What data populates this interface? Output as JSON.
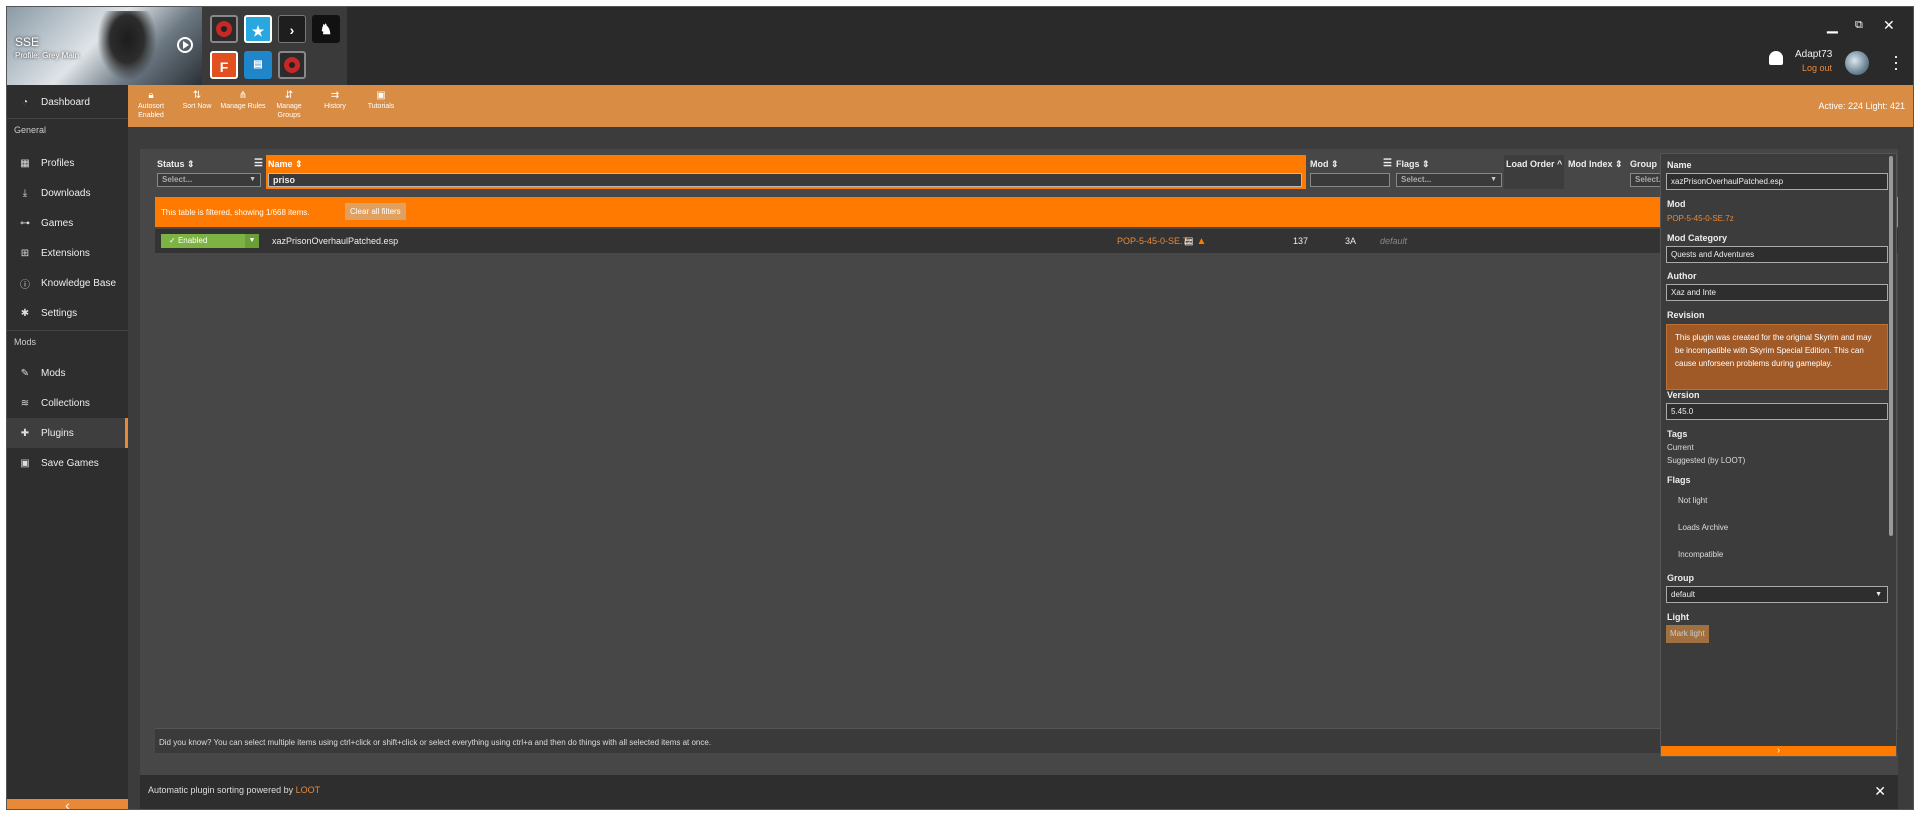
{
  "game": {
    "title": "SSE",
    "profile": "Profile: Grey Main"
  },
  "tools": [
    {
      "name": "record-tool-icon",
      "bg": "#b22222"
    },
    {
      "name": "star-tool-icon",
      "bg": "#29a8e0"
    },
    {
      "name": "chevron-tool-icon",
      "bg": "#222222"
    },
    {
      "name": "horse-tool-icon",
      "bg": "#111111"
    },
    {
      "name": "f-tool-icon",
      "bg": "#e05020",
      "label": "F"
    },
    {
      "name": "file-tool-icon",
      "bg": "#29a8e0"
    },
    {
      "name": "record2-tool-icon",
      "bg": "#b22222"
    }
  ],
  "user": {
    "name": "Adapt73",
    "logout": "Log out"
  },
  "sidebar": {
    "dashboard": "Dashboard",
    "section_general": "General",
    "profiles": "Profiles",
    "downloads": "Downloads",
    "games": "Games",
    "extensions": "Extensions",
    "knowledge_base": "Knowledge Base",
    "settings": "Settings",
    "section_mods": "Mods",
    "mods": "Mods",
    "collections": "Collections",
    "plugins": "Plugins",
    "save_games": "Save Games"
  },
  "toolbar": {
    "autosort": "Autosort Enabled",
    "sort_now": "Sort Now",
    "manage_rules": "Manage Rules",
    "manage_groups": "Manage Groups",
    "history": "History",
    "tutorials": "Tutorials",
    "active_light": "Active: 224 Light: 421"
  },
  "table": {
    "headers": {
      "status": "Status",
      "name": "Name",
      "mod": "Mod",
      "flags": "Flags",
      "load_order": "Load Order",
      "mod_index": "Mod Index",
      "group": "Group"
    },
    "status_placeholder": "Select...",
    "name_filter": "priso",
    "flags_placeholder": "Select...",
    "group_placeholder": "Select...",
    "filter_notice": "This table is filtered, showing 1/668 items.",
    "clear_filters": "Clear all filters",
    "rows": [
      {
        "status": "Enabled",
        "name": "xazPrisonOverhaulPatched.esp",
        "mod": "POP-5-45-0-SE.7z",
        "load_order": "137",
        "mod_index": "3A",
        "group": "default"
      }
    ],
    "hint": "Did you know? You can select multiple items using ctrl+click or shift+click or select everything using ctrl+a and then do things with all selected items at once."
  },
  "footer": {
    "loot_prefix": "Automatic plugin sorting powered by ",
    "loot_link": "LOOT"
  },
  "details": {
    "name_label": "Name",
    "name_value": "xazPrisonOverhaulPatched.esp",
    "mod_label": "Mod",
    "mod_value": "POP-5-45-0-SE.7z",
    "category_label": "Mod Category",
    "category_value": "Quests and Adventures",
    "author_label": "Author",
    "author_value": "Xaz and Inte",
    "revision_label": "Revision",
    "revision_text": "This plugin was created for the original Skyrim and may be incompatible with Skyrim Special Edition. This can cause unforseen problems during gameplay.",
    "version_label": "Version",
    "version_value": "5.45.0",
    "tags_label": "Tags",
    "tags": [
      "Current",
      "Suggested (by LOOT)"
    ],
    "flags_label": "Flags",
    "flags": [
      "Not light",
      "Loads Archive",
      "Incompatible"
    ],
    "group_label": "Group",
    "group_value": "default",
    "light_label": "Light",
    "mark_light": "Mark light"
  },
  "colors": {
    "accent": "#e8893a",
    "filter_orange": "#ff7a00",
    "enabled_green": "#7cb342"
  }
}
